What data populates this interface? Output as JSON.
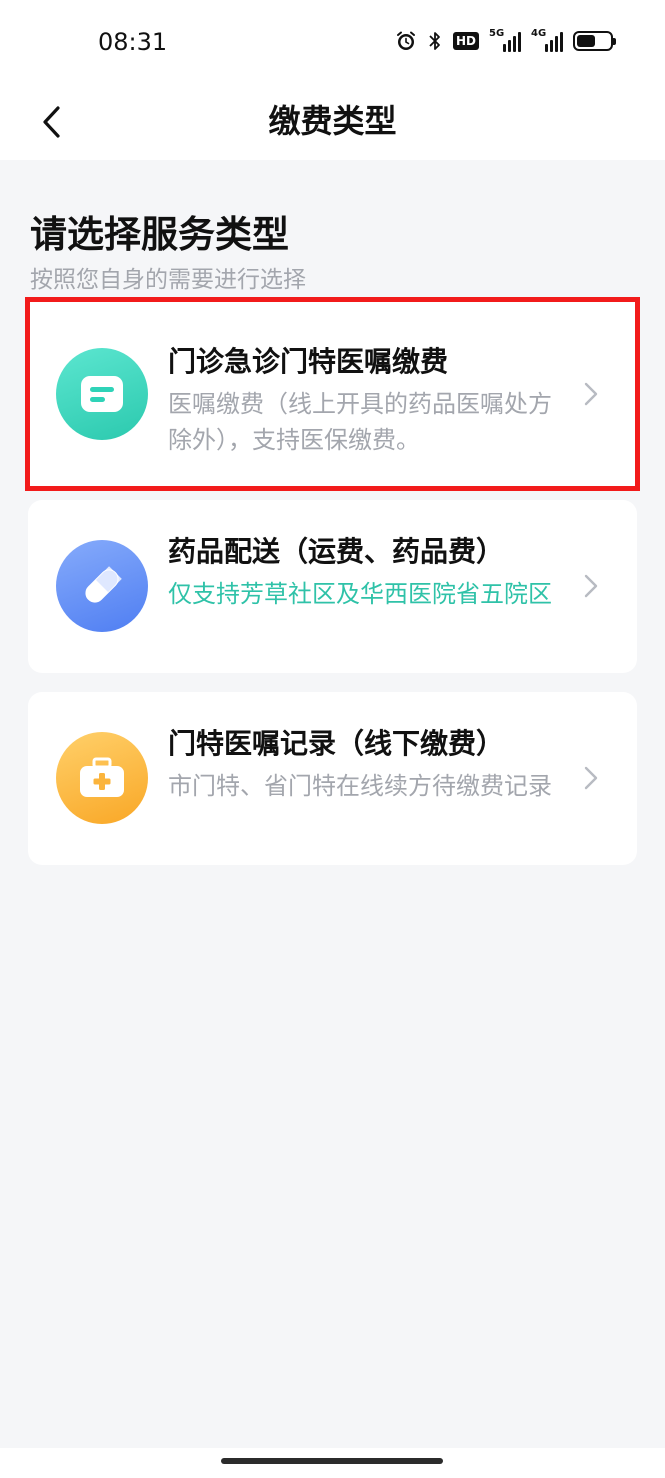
{
  "status_bar": {
    "time": "08:31",
    "hd_badge": "HD",
    "sig1_label": "5G",
    "sig2_label": "4G",
    "battery_level": 0.55
  },
  "nav": {
    "title": "缴费类型",
    "back_icon": "chevron-left-icon"
  },
  "section": {
    "title": "请选择服务类型",
    "subtitle": "按照您自身的需要进行选择"
  },
  "cards": [
    {
      "title": "门诊急诊门特医嘱缴费",
      "desc": "医嘱缴费（线上开具的药品医嘱处方除外），支持医保缴费。",
      "icon": "message-card-icon",
      "icon_color": "#2fd3b8",
      "selected": true
    },
    {
      "title": "药品配送（运费、药品费）",
      "desc": "仅支持芳草社区及华西医院省五院区",
      "icon": "pill-icon",
      "icon_color": "#5b8ef5",
      "accent_color": "#2fc2a8"
    },
    {
      "title": "门特医嘱记录（线下缴费）",
      "desc": "市门特、省门特在线续方待缴费记录",
      "icon": "medical-kit-icon",
      "icon_color": "#fbb43c"
    }
  ],
  "colors": {
    "background": "#f5f6f8",
    "selection_outline": "#f21b1b",
    "muted_text": "#a3a6ad"
  }
}
